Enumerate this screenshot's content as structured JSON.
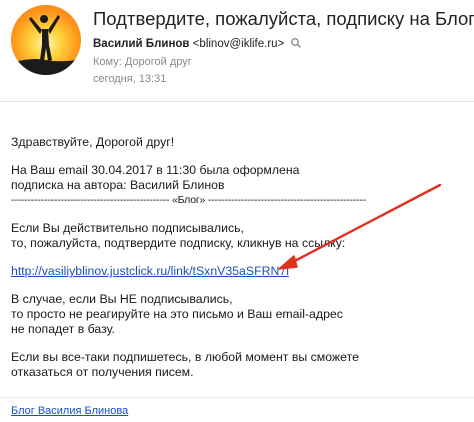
{
  "header": {
    "subject": "Подтвердите, пожалуйста, подписку на Блог",
    "sender_name": "Василий Блинов",
    "sender_email": "<blinov@iklife.ru>",
    "to_label": "Кому: Дорогой друг",
    "date": "сегодня, 13:31"
  },
  "message": {
    "greeting": "Здравствуйте, Дорогой друг!",
    "line1": "На Ваш email 30.04.2017 в 11:30 была оформлена",
    "line2": "подписка на автора: Василий Блинов",
    "separator": "------------------------------------------------ «Блог» ------------------------------------------------",
    "confirm1": "Если Вы действительно подписывались,",
    "confirm2": "то, пожалуйста, подтвердите подписку, кликнув на ссылку:",
    "link": "http://vasiliyblinov.justclick.ru/link/tSxnV35aSFRN7l",
    "ignore1": "В случае, если Вы НЕ подписывались,",
    "ignore2": "то просто не реагируйте на это письмо и Ваш email-адрес",
    "ignore3": "не попадет в базу.",
    "unsub1": "Если вы все-таки подпишетесь, в любой момент вы сможете",
    "unsub2": "отказаться от получения писем."
  },
  "footer": {
    "blog_link": "Блог Василия Блинова"
  },
  "colors": {
    "link": "#1a4fbf",
    "annotation_arrow": "#e0301e"
  },
  "icons": [
    "avatar-silhouette",
    "magnifier-icon",
    "annotation-arrow"
  ]
}
